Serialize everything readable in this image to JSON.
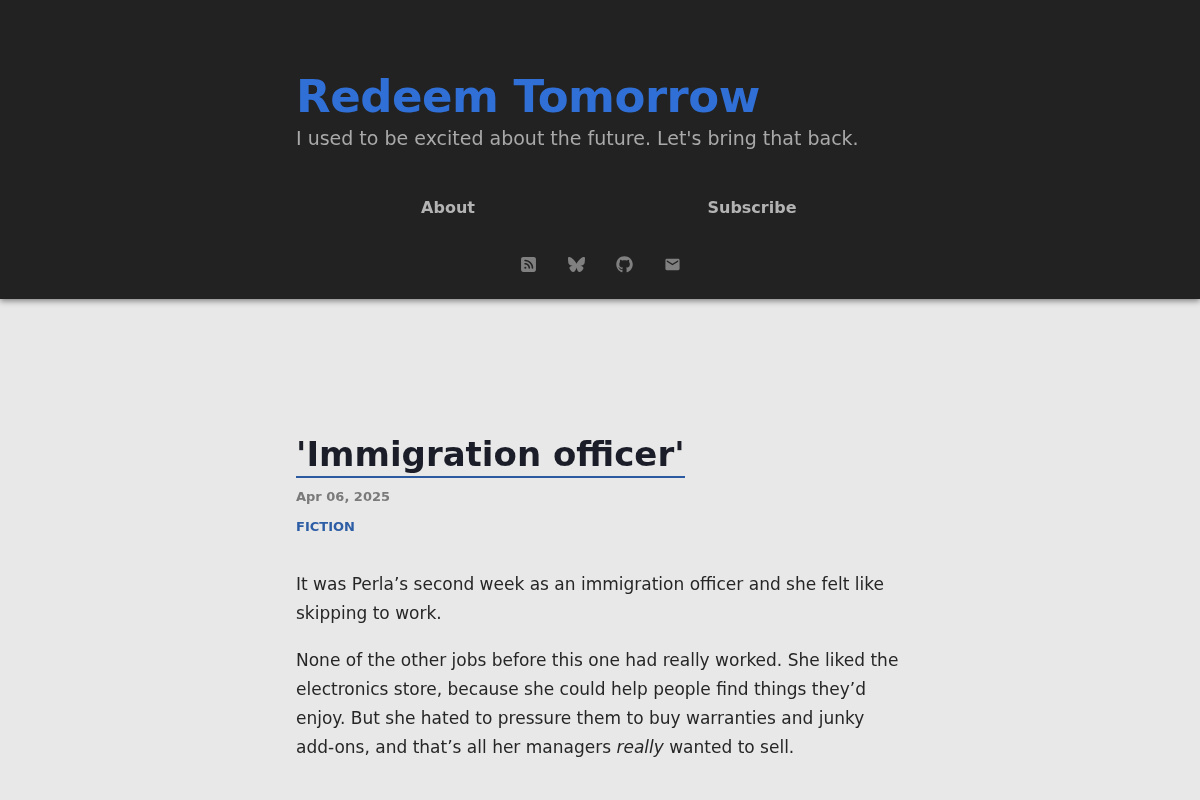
{
  "site": {
    "title": "Redeem Tomorrow",
    "tagline": "I used to be excited about the future. Let's bring that back."
  },
  "nav": [
    {
      "label": "About"
    },
    {
      "label": "Subscribe"
    }
  ],
  "post": {
    "title": "'Immigration officer'",
    "date": "Apr 06, 2025",
    "tags": [
      "FICTION"
    ],
    "paragraphs": [
      "It was Perla’s second week as an immigration officer and she felt like skipping to work.",
      "None of the other jobs before this one had really worked. She liked the electronics store, because she could help people find things they’d enjoy. But she hated to pressure them to buy warranties and junky add-ons, and that’s all her managers *really* wanted to sell."
    ]
  }
}
